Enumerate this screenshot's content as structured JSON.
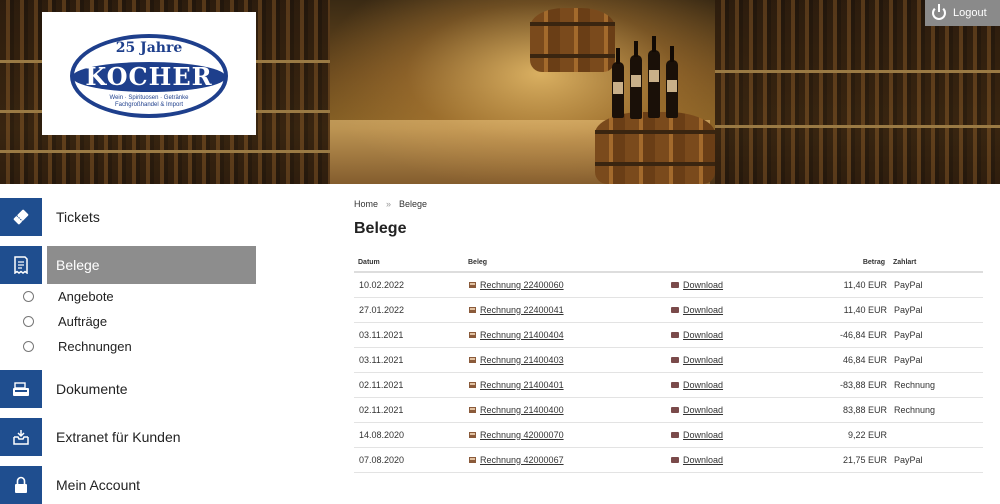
{
  "header": {
    "logo": {
      "jubilee": "25 Jahre",
      "name": "KOCHER",
      "tagline": "Wein · Spirituosen · Getränke\nFachgroßhandel & Import"
    },
    "logout_label": "Logout"
  },
  "sidebar": {
    "items": [
      {
        "label": "Tickets",
        "icon": "ticket-icon"
      },
      {
        "label": "Belege",
        "icon": "receipt-icon",
        "active": true
      },
      {
        "label": "Dokumente",
        "icon": "cash-register-icon"
      },
      {
        "label": "Extranet für Kunden",
        "icon": "inbox-tray-icon"
      },
      {
        "label": "Mein Account",
        "icon": "lock-icon"
      }
    ],
    "sub_items": [
      {
        "label": "Angebote"
      },
      {
        "label": "Aufträge"
      },
      {
        "label": "Rechnungen"
      }
    ]
  },
  "breadcrumb": {
    "home": "Home",
    "separator": "»",
    "current": "Belege"
  },
  "page_title": "Belege",
  "table": {
    "headers": {
      "date": "Datum",
      "doc": "Beleg",
      "amount": "Betrag",
      "payment": "Zahlart"
    },
    "rows": [
      {
        "date": "10.02.2022",
        "doc": "Rechnung 22400060",
        "download": "Download",
        "amount": "11,40 EUR",
        "payment": "PayPal"
      },
      {
        "date": "27.01.2022",
        "doc": "Rechnung 22400041",
        "download": "Download",
        "amount": "11,40 EUR",
        "payment": "PayPal"
      },
      {
        "date": "03.11.2021",
        "doc": "Rechnung 21400404",
        "download": "Download",
        "amount": "-46,84 EUR",
        "payment": "PayPal"
      },
      {
        "date": "03.11.2021",
        "doc": "Rechnung 21400403",
        "download": "Download",
        "amount": "46,84 EUR",
        "payment": "PayPal"
      },
      {
        "date": "02.11.2021",
        "doc": "Rechnung 21400401",
        "download": "Download",
        "amount": "-83,88 EUR",
        "payment": "Rechnung"
      },
      {
        "date": "02.11.2021",
        "doc": "Rechnung 21400400",
        "download": "Download",
        "amount": "83,88 EUR",
        "payment": "Rechnung"
      },
      {
        "date": "14.08.2020",
        "doc": "Rechnung 42000070",
        "download": "Download",
        "amount": "9,22 EUR",
        "payment": ""
      },
      {
        "date": "07.08.2020",
        "doc": "Rechnung 42000067",
        "download": "Download",
        "amount": "21,75 EUR",
        "payment": "PayPal"
      }
    ]
  },
  "colors": {
    "nav_blue": "#1f4e8f",
    "active_gray": "#8d8d8d",
    "logo_blue": "#1e3f8c"
  }
}
